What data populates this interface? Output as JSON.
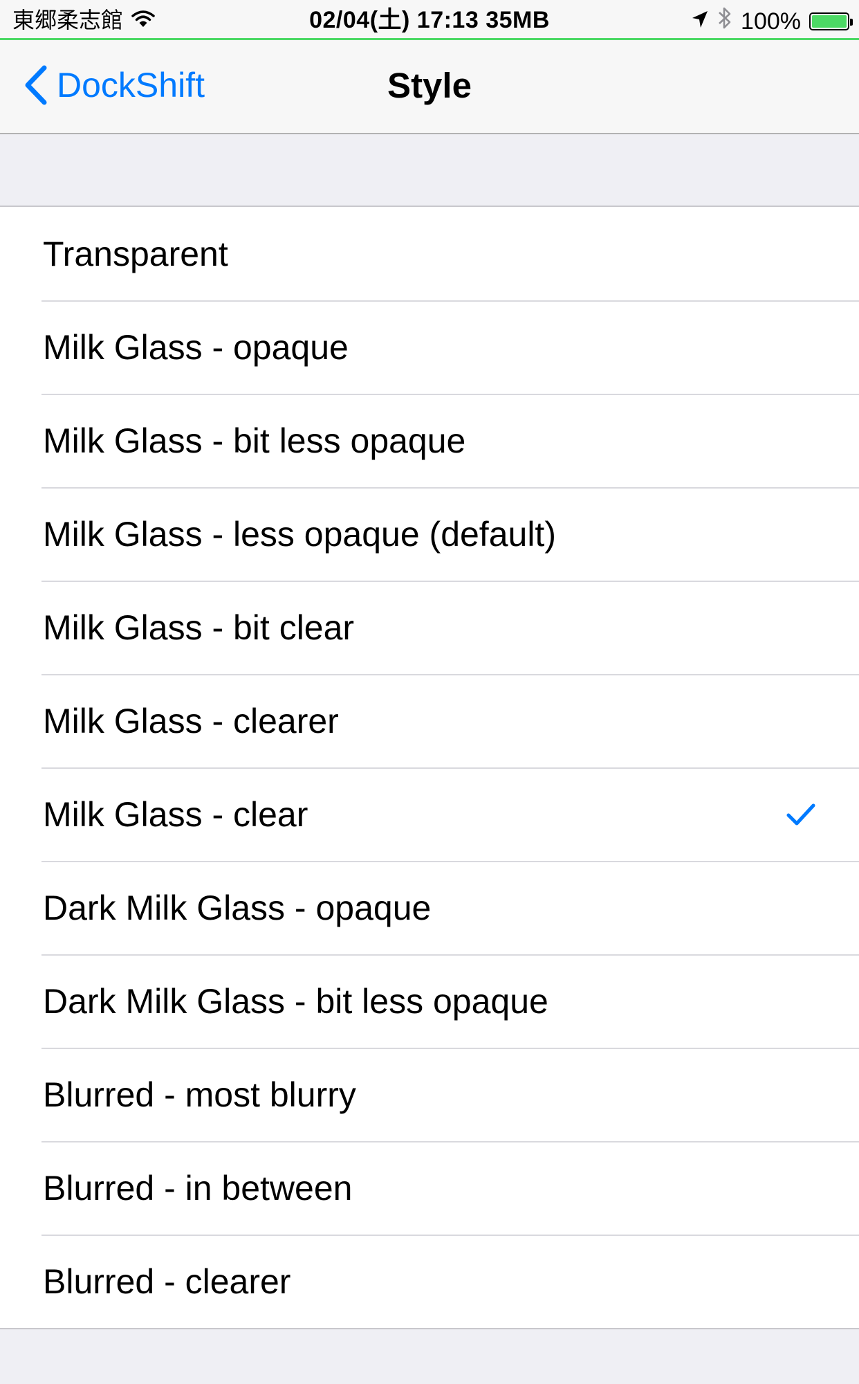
{
  "status_bar": {
    "carrier": "東郷柔志館",
    "center_text": "02/04(土) 17:13 35MB",
    "battery_percent": "100%",
    "battery_level": 1.0,
    "icons": [
      "wifi-icon",
      "location-arrow-icon",
      "bluetooth-icon",
      "battery-icon"
    ]
  },
  "nav": {
    "back_label": "DockShift",
    "title": "Style"
  },
  "list": {
    "items": [
      {
        "label": "Transparent",
        "selected": false
      },
      {
        "label": "Milk Glass - opaque",
        "selected": false
      },
      {
        "label": "Milk Glass - bit less opaque",
        "selected": false
      },
      {
        "label": "Milk Glass - less opaque (default)",
        "selected": false
      },
      {
        "label": "Milk Glass - bit clear",
        "selected": false
      },
      {
        "label": "Milk Glass - clearer",
        "selected": false
      },
      {
        "label": "Milk Glass - clear",
        "selected": true
      },
      {
        "label": "Dark Milk Glass - opaque",
        "selected": false
      },
      {
        "label": "Dark Milk Glass - bit less opaque",
        "selected": false
      },
      {
        "label": "Blurred - most blurry",
        "selected": false
      },
      {
        "label": "Blurred - in between",
        "selected": false
      },
      {
        "label": "Blurred - clearer",
        "selected": false
      }
    ]
  },
  "colors": {
    "accent": "#007aff",
    "battery_green": "#4cd964",
    "background": "#efeff4"
  }
}
